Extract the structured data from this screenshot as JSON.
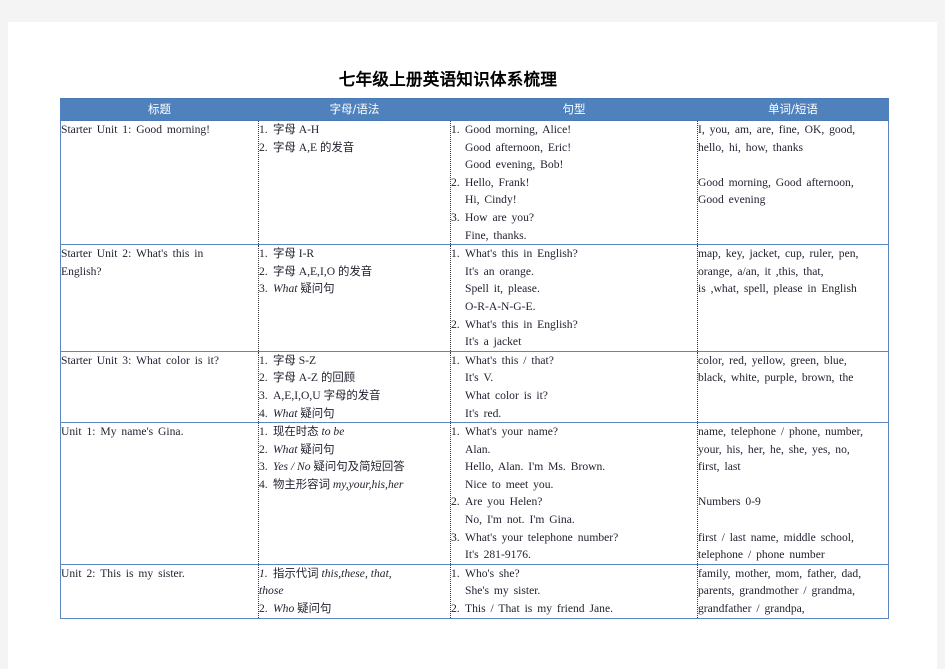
{
  "document": {
    "title": "七年级上册英语知识体系梳理"
  },
  "table": {
    "headers": [
      {
        "label": "标题",
        "name": "column-header-title"
      },
      {
        "label": "字母/语法",
        "name": "column-header-grammar"
      },
      {
        "label": "句型",
        "name": "column-header-sentence-pattern"
      },
      {
        "label": "单词/短语",
        "name": "column-header-words"
      }
    ],
    "rows": [
      {
        "title": "Starter Unit 1: Good morning!",
        "grammar": {
          "l1n": "1.",
          "l1a": "字母",
          "l1b": "A-H",
          "l2n": "2.",
          "l2a": "字母",
          "l2b": "A,E",
          "l2c": "的发音"
        },
        "pattern": {
          "p1n": "1.",
          "p1": "Good morning, Alice!",
          "p2": "Good afternoon, Eric!",
          "p3": "Good evening, Bob!",
          "p4n": "2.",
          "p4": "Hello, Frank!",
          "p5": "Hi, Cindy!",
          "p6n": "3.",
          "p6": "How are you?",
          "p7": "Fine, thanks."
        },
        "words": {
          "w1": "I, you, am, are, fine, OK, good,",
          "w2": "hello, hi, how, thanks",
          "w3": "Good morning, Good afternoon,",
          "w4": "Good evening"
        }
      },
      {
        "title_l1": "Starter Unit 2: What's this in",
        "title_l2": "English?",
        "grammar": {
          "l1n": "1.",
          "l1a": "字母",
          "l1b": "I-R",
          "l2n": "2.",
          "l2a": "字母",
          "l2b": "A,E,I,O",
          "l2c": "的发音",
          "l3n": "3.",
          "l3a": "What",
          "l3b": "疑问句"
        },
        "pattern": {
          "p1n": "1.",
          "p1": "What's this in English?",
          "p2": "It's an orange.",
          "p3": "Spell it, please.",
          "p4": "O-R-A-N-G-E.",
          "p5n": "2.",
          "p5": "What's this in English?",
          "p6": "It's a jacket"
        },
        "words": {
          "w1": "map, key, jacket, cup, ruler, pen,",
          "w2": "orange, a/an, it ,this, that,",
          "w3": "is ,what, spell, please in English"
        }
      },
      {
        "title": "Starter Unit 3: What color is it?",
        "grammar": {
          "l1n": "1.",
          "l1a": "字母",
          "l1b": "S-Z",
          "l2n": "2.",
          "l2a": "字母",
          "l2b": "A-Z",
          "l2c": "的回顾",
          "l3n": "3.",
          "l3b": "A,E,I,O,U",
          "l3c": "字母的发音",
          "l4n": "4.",
          "l4a": "What",
          "l4b": "疑问句"
        },
        "pattern": {
          "p1n": "1.",
          "p1": "What's this / that?",
          "p2": "It's V.",
          "p3": "What color is it?",
          "p4": "It's red."
        },
        "words": {
          "w1": "color, red, yellow, green, blue,",
          "w2": "black, white, purple, brown, the"
        }
      },
      {
        "title": "Unit 1: My name's Gina.",
        "grammar": {
          "l1n": "1.",
          "l1a": "现在时态",
          "l1i": "to be",
          "l2n": "2.",
          "l2i": "What",
          "l2a": "疑问句",
          "l3n": "3.",
          "l3i": "Yes / No",
          "l3a": "疑问句及简短回答",
          "l4n": "4.",
          "l4a": "物主形容词",
          "l4i": "my,your,his,her"
        },
        "pattern": {
          "p1n": "1.",
          "p1": "What's your name?",
          "p2": "Alan.",
          "p3": "Hello, Alan. I'm Ms. Brown.",
          "p4": "Nice to meet you.",
          "p5n": "2.",
          "p5": "Are you Helen?",
          "p6": "No, I'm not. I'm Gina.",
          "p7n": "3.",
          "p7": "What's your telephone number?",
          "p8": "It's 281-9176."
        },
        "words": {
          "w1": "name, telephone / phone, number,",
          "w2": "your, his, her, he, she, yes, no,",
          "w3": "first, last",
          "w4": "Numbers 0-9",
          "w5": "first / last name, middle school,",
          "w6": "telephone / phone number"
        }
      },
      {
        "title": "Unit 2: This is my sister.",
        "grammar": {
          "l1n": "1.",
          "l1a": "指示代词",
          "l1i": "this,these, that,",
          "l1i2": "those",
          "l2n": "2.",
          "l2i": "Who",
          "l2a": "疑问句"
        },
        "pattern": {
          "p1n": "1.",
          "p1": "Who's she?",
          "p2": "She's my sister.",
          "p3n": "2.",
          "p3": "This / That is my friend Jane."
        },
        "words": {
          "w1": "family, mother, mom, father, dad,",
          "w2": "parents, grandmother / grandma,",
          "w3": "grandfather / grandpa,"
        }
      }
    ]
  },
  "colors": {
    "header_bg": "#4f81bd",
    "border": "#5b86bf",
    "page_bg": "#f4f4f4",
    "text": "#1f1f2e"
  }
}
